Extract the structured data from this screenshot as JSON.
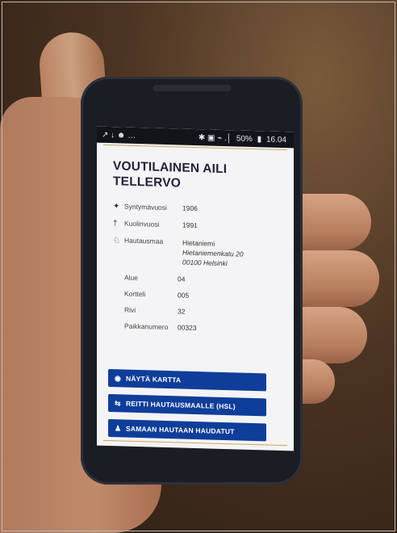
{
  "status": {
    "left_icons": "↗ ↓ ☻ …",
    "right_icons": "✱ ▣ ⌁ .│",
    "battery": "50%",
    "time": "16.04"
  },
  "record": {
    "name": "VOUTILAINEN AILI TELLERVO",
    "fields": [
      {
        "icon": "✦",
        "label": "Syntymävuosi",
        "value": "1906"
      },
      {
        "icon": "†",
        "label": "Kuolinvuosi",
        "value": "1991"
      }
    ],
    "cemetery": {
      "icon": "♘",
      "label": "Hautausmaa",
      "name": "Hietaniemi",
      "street": "Hietaniemenkatu 20",
      "city": "00100 Helsinki"
    },
    "grave": [
      {
        "label": "Alue",
        "value": "04"
      },
      {
        "label": "Kortteli",
        "value": "005"
      },
      {
        "label": "Rivi",
        "value": "32"
      },
      {
        "label": "Paikkanumero",
        "value": "00323"
      }
    ]
  },
  "buttons": [
    {
      "icon": "◉",
      "label": "NÄYTÄ KARTTA"
    },
    {
      "icon": "⇆",
      "label": "REITTI HAUTAUSMAALLE (HSL)"
    },
    {
      "icon": "♟",
      "label": "SAMAAN HAUTAAN HAUDATUT"
    }
  ]
}
